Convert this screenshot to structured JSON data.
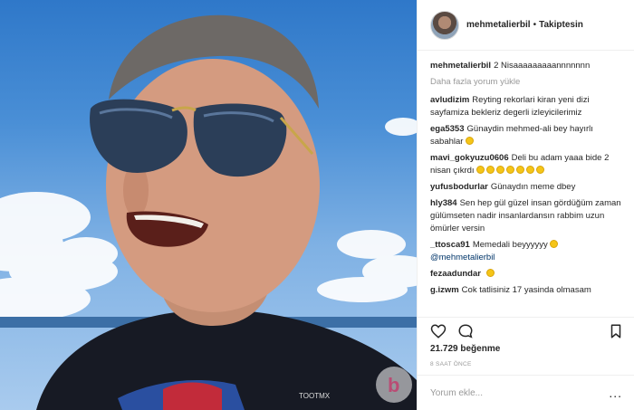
{
  "post_header": {
    "username": "mehmetalierbil",
    "separator": "•",
    "follow_status": "Takiptesin"
  },
  "caption": {
    "username": "mehmetalierbil",
    "text": "2 Nisaaaaaaaaannnnnnn"
  },
  "load_more_label": "Daha fazla yorum yükle",
  "comments": [
    {
      "username": "avludizim",
      "text": "Reyting rekorlari kiran yeni dizi sayfamiza bekleriz degerli izleyicilerimiz"
    },
    {
      "username": "ega5353",
      "text": "Günaydin mehmed-ali bey hayırlı sabahlar"
    },
    {
      "username": "mavi_gokyuzu0606",
      "text": "Deli bu adam yaaa bide 2 nisan çıkrdı"
    },
    {
      "username": "yufusbodurlar",
      "text": "Günaydın meme dbey"
    },
    {
      "username": "hly384",
      "text": "Sen hep gül güzel insan gördüğüm zaman gülümseten nadir insanlardansın rabbim uzun ömürler versin"
    },
    {
      "username": "_ttosca91",
      "text": "Memedali beyyyyyy",
      "mention": "@mehmetalierbil"
    },
    {
      "username": "fezaadundar",
      "text": ""
    },
    {
      "username": "g.izwm",
      "text": "Cok tatlisiniz 17 yasinda olmasam"
    }
  ],
  "icons": {
    "like": "heart-icon",
    "comment": "comment-bubble-icon",
    "save": "bookmark-icon",
    "emoji": "emoji-icon"
  },
  "likes_label": "21.729 beğenme",
  "timestamp": "8 SAAT ÖNCE",
  "add_comment": {
    "placeholder": "Yorum ekle...",
    "options": "..."
  },
  "photo_overlay_text": "TOOTMX",
  "colors": {
    "sky": "#4a8fd6",
    "border": "#efefef",
    "muted": "#999999",
    "mention": "#003569"
  }
}
